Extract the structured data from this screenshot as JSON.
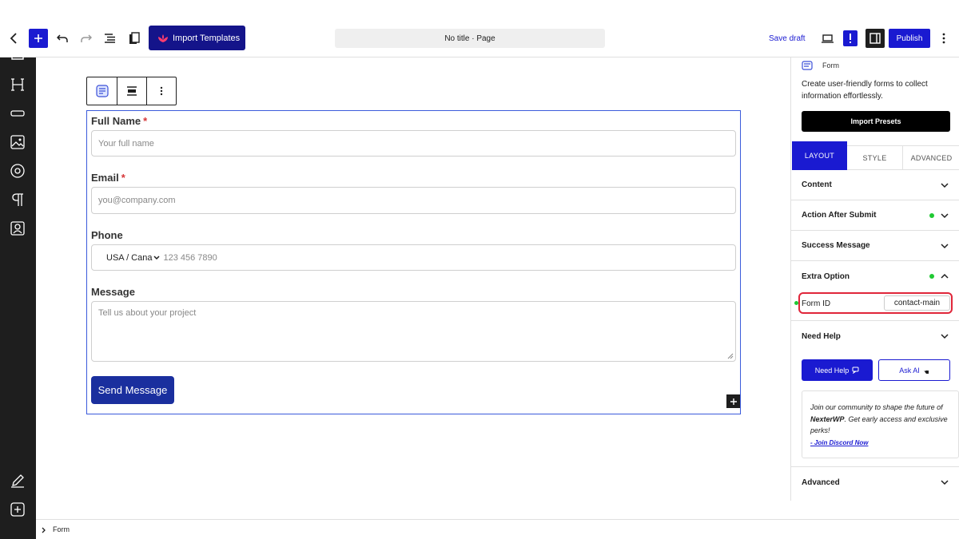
{
  "topbar": {
    "import_templates_label": "Import Templates",
    "document_title": "No title · Page",
    "save_draft_label": "Save draft",
    "publish_label": "Publish"
  },
  "form": {
    "full_name_label": "Full Name",
    "full_name_placeholder": "Your full name",
    "email_label": "Email",
    "email_placeholder": "you@company.com",
    "phone_label": "Phone",
    "phone_country": "USA / Cana",
    "phone_placeholder": "123 456 7890",
    "message_label": "Message",
    "message_placeholder": "Tell us about your project",
    "submit_label": "Send Message",
    "required_marker": "*"
  },
  "sidebar": {
    "block_name": "Form",
    "block_description": "Create user-friendly forms to collect information effortlessly.",
    "import_presets_label": "Import Presets",
    "tabs": [
      "LAYOUT",
      "STYLE",
      "ADVANCED"
    ],
    "sections": {
      "content": "Content",
      "action_after_submit": "Action After Submit",
      "success_message": "Success Message",
      "extra_option": "Extra Option",
      "need_help": "Need Help",
      "advanced": "Advanced"
    },
    "form_id_label": "Form ID",
    "form_id_value": "contact-main",
    "need_help_button": "Need Help",
    "ask_ai_button": "Ask AI",
    "community_text_1": "Join our community to shape the future of ",
    "community_brand": "NexterWP",
    "community_text_2": ". Get early access and exclusive perks!",
    "discord_link": "- Join Discord Now"
  },
  "footer": {
    "breadcrumb_item": "Form"
  },
  "colors": {
    "accent_blue": "#1a1ad1",
    "import_templates_bg": "#14148a",
    "submit_bg": "#1a2f9e",
    "status_green": "#20c933",
    "highlight_red": "#e0263a",
    "dark_rail": "#1e1e1e"
  }
}
